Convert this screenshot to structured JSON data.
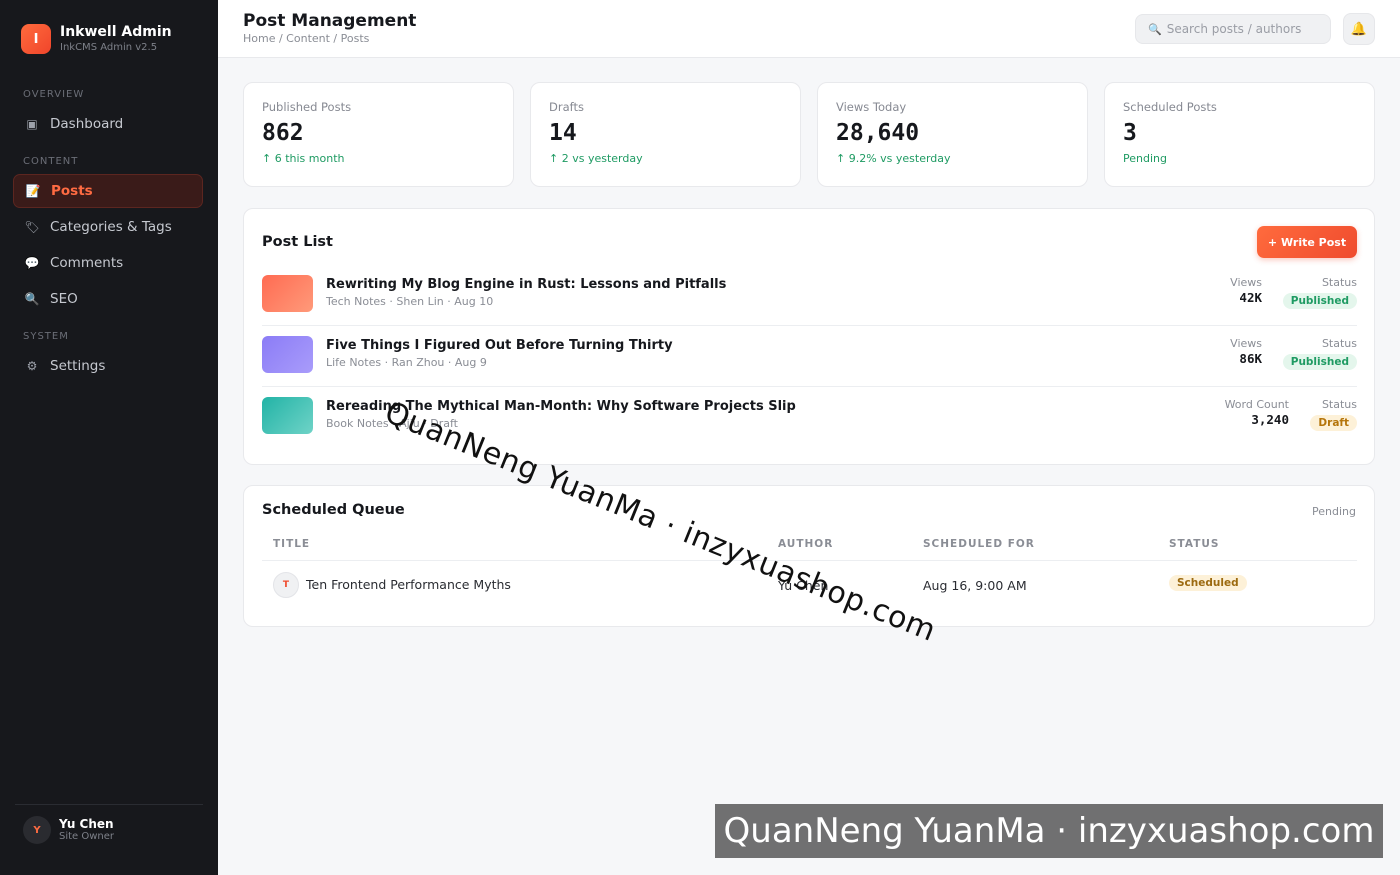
{
  "brand": {
    "logo_letter": "I",
    "name": "Inkwell Admin",
    "version": "InkCMS Admin v2.5"
  },
  "sidebar": {
    "sections": {
      "overview": "OVERVIEW",
      "content": "CONTENT",
      "system": "SYSTEM"
    },
    "items": [
      {
        "label": "Dashboard",
        "icon": "dashboard-icon",
        "glyph": "▣"
      },
      {
        "label": "Posts",
        "icon": "memo-icon",
        "glyph": "📝",
        "active": true
      },
      {
        "label": "Categories & Tags",
        "icon": "tag-icon",
        "glyph": "🏷"
      },
      {
        "label": "Comments",
        "icon": "speech-bubble-icon",
        "glyph": "💬"
      },
      {
        "label": "SEO",
        "icon": "magnifier-icon",
        "glyph": "🔍"
      },
      {
        "label": "Settings",
        "icon": "gear-icon",
        "glyph": "⚙"
      }
    ]
  },
  "user": {
    "initial": "Y",
    "name": "Yu Chen",
    "role": "Site Owner"
  },
  "header": {
    "title": "Post Management",
    "breadcrumb": "Home / Content / Posts",
    "search_placeholder": "Search posts / authors",
    "search_icon": "🔍",
    "bell_icon": "🔔"
  },
  "stats": [
    {
      "label": "Published Posts",
      "value": "862",
      "delta": "↑ 6 this month"
    },
    {
      "label": "Drafts",
      "value": "14",
      "delta": "↑ 2 vs yesterday"
    },
    {
      "label": "Views Today",
      "value": "28,640",
      "delta": "↑ 9.2% vs yesterday"
    },
    {
      "label": "Scheduled Posts",
      "value": "3",
      "delta": "Pending"
    }
  ],
  "post_list": {
    "title": "Post List",
    "write_button": "+ Write Post",
    "posts": [
      {
        "title": "Rewriting My Blog Engine in Rust: Lessons and Pitfalls",
        "meta": "Tech Notes · Shen Lin · Aug 10",
        "metric_label": "Views",
        "metric_value": "42K",
        "status_label": "Status",
        "status": "Published",
        "thumb_colors": [
          "#ff6b52",
          "#ff9a7a"
        ]
      },
      {
        "title": "Five Things I Figured Out Before Turning Thirty",
        "meta": "Life Notes · Ran Zhou · Aug 9",
        "metric_label": "Views",
        "metric_value": "86K",
        "status_label": "Status",
        "status": "Published",
        "thumb_colors": [
          "#8b7cf6",
          "#a99cfb"
        ]
      },
      {
        "title": "Rereading The Mythical Man-Month: Why Software Projects Slip",
        "meta": "Book Notes · Ajiu · Draft",
        "metric_label": "Word Count",
        "metric_value": "3,240",
        "status_label": "Status",
        "status": "Draft",
        "thumb_colors": [
          "#22b3a6",
          "#6fd3c7"
        ]
      }
    ]
  },
  "queue": {
    "title": "Scheduled Queue",
    "pending": "Pending",
    "columns": [
      "TITLE",
      "AUTHOR",
      "SCHEDULED FOR",
      "STATUS"
    ],
    "rows": [
      {
        "initial": "T",
        "title": "Ten Frontend Performance Myths",
        "author": "Yu Chen",
        "scheduled": "Aug 16, 9:00 AM",
        "status": "Scheduled"
      }
    ]
  },
  "watermark": {
    "text": "QuanNeng YuanMa · inzyxuashop.com"
  },
  "colors": {
    "accent": "#ef4b2e",
    "sidebar_bg": "#17181c",
    "success": "#1f9b63",
    "warning": "#b5750b"
  }
}
